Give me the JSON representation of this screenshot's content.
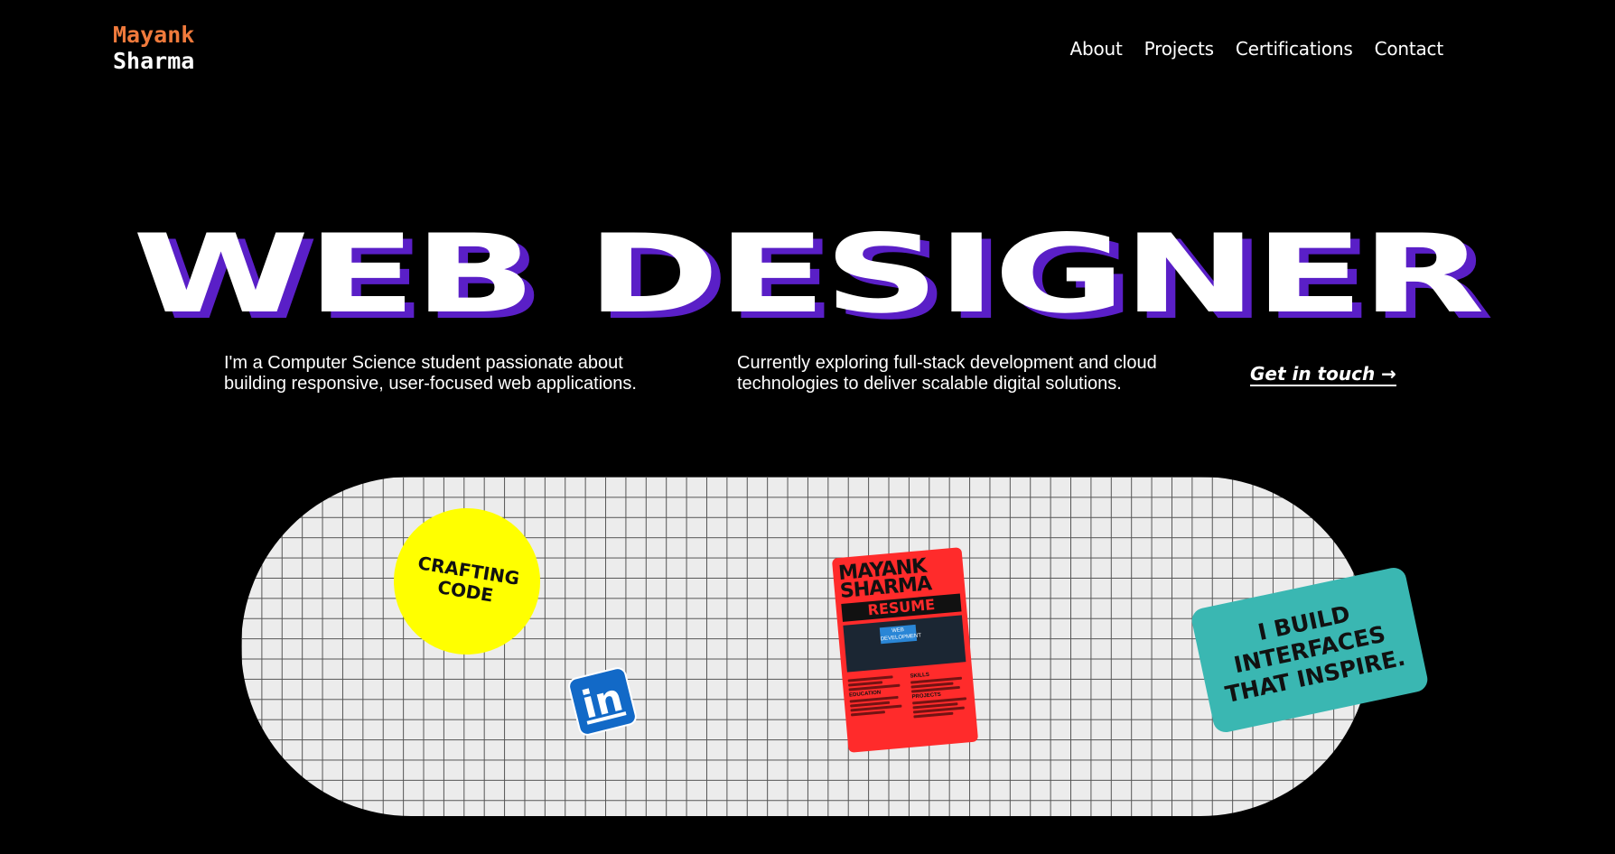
{
  "brand": {
    "first": "Mayank",
    "last": "Sharma",
    "first_color": "#f07a3c"
  },
  "nav": {
    "items": [
      "About",
      "Projects",
      "Certifications",
      "Contact"
    ]
  },
  "hero": {
    "title": "WEB DESIGNER",
    "shadow_color": "#5a1fc7",
    "intro_left": "I'm a Computer Science student passionate about building responsive, user-focused web applications.",
    "intro_right": "Currently exploring full-stack development and cloud technologies to deliver scalable digital solutions.",
    "cta": "Get in touch →"
  },
  "stickers": {
    "circle_text": "CRAFTING CODE",
    "circle_color": "#ffff00",
    "linkedin_label": "in",
    "linkedin_icon": "linkedin-icon",
    "resume": {
      "name": "MAYANK SHARMA",
      "band": "RESUME",
      "screen_text": "WEB DEVELOPMENT",
      "sections": [
        "SKILLS",
        "EDUCATION",
        "PROJECTS"
      ]
    },
    "tagline": "I BUILD INTERFACES THAT INSPIRE.",
    "tagline_color": "#3ab7b2"
  }
}
